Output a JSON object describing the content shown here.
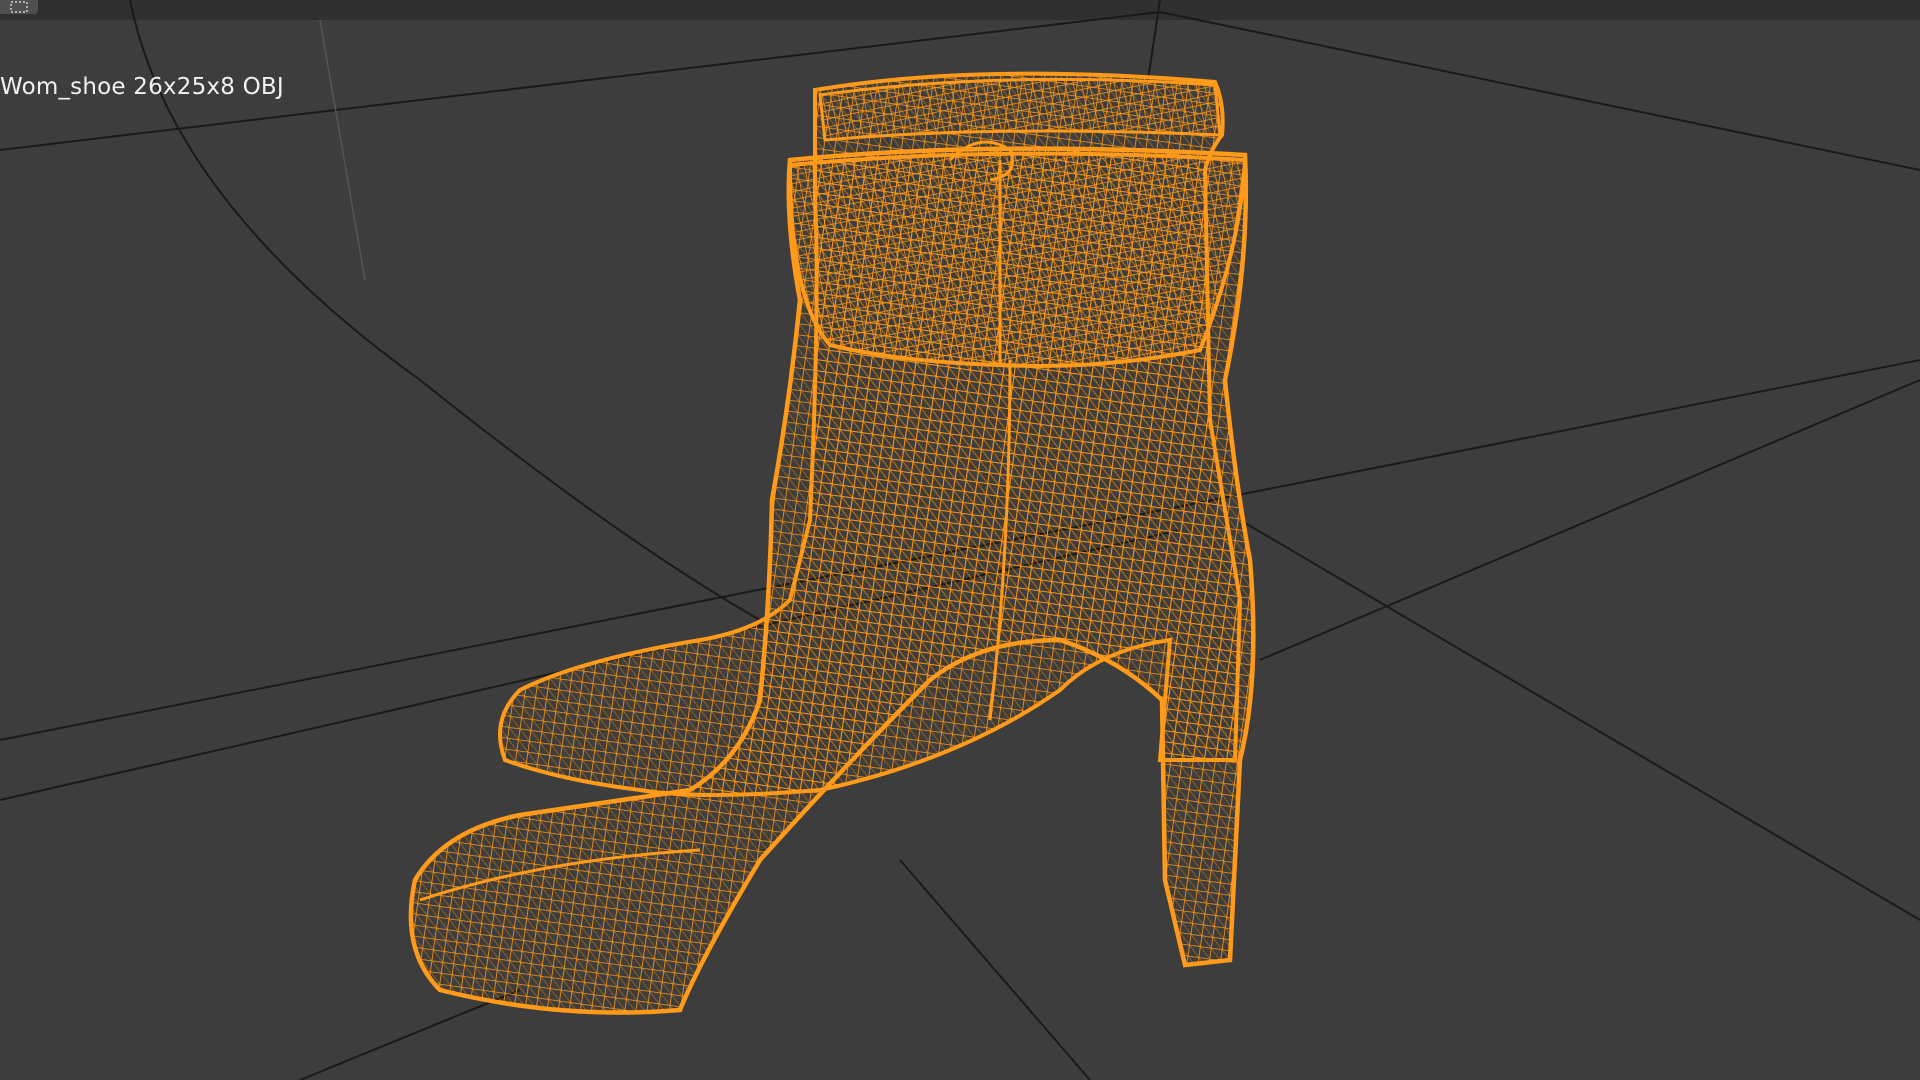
{
  "viewport": {
    "object_label": "Wom_shoe 26x25x8 OBJ",
    "corner_icon": "editor-type-icon",
    "model_icon": "wireframe-mesh-icon",
    "colors": {
      "background": "#3d3d3d",
      "header": "#303030",
      "wireframe": "#ff9a1a",
      "wireframe_dark": "#c96d00",
      "grid": "#1a1a1a",
      "label_text": "#f2f2f2"
    }
  }
}
